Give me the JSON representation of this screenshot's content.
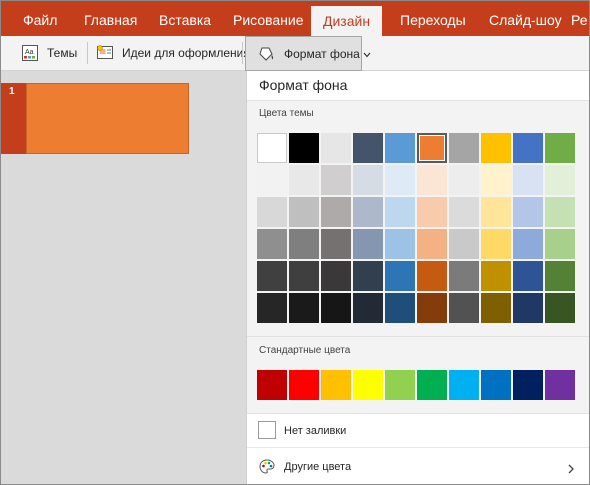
{
  "ribbon": {
    "tabs": [
      {
        "label": "Файл"
      },
      {
        "label": "Главная"
      },
      {
        "label": "Вставка"
      },
      {
        "label": "Рисование"
      },
      {
        "label": "Дизайн",
        "active": true
      },
      {
        "label": "Переходы"
      },
      {
        "label": "Слайд-шоу"
      },
      {
        "label": "Ре"
      }
    ]
  },
  "toolbar": {
    "themes_label": "Темы",
    "design_ideas_label": "Идеи для оформления",
    "format_bg_label": "Формат фона"
  },
  "slides": {
    "items": [
      {
        "number": "1",
        "color": "#ed7d31"
      }
    ]
  },
  "panel": {
    "title": "Формат фона",
    "theme_colors_label": "Цвета темы",
    "standard_colors_label": "Стандартные цвета",
    "no_fill_label": "Нет заливки",
    "more_colors_label": "Другие цвета",
    "selected_color": "#ed7d31",
    "theme_colors": [
      [
        "#ffffff",
        "#000000",
        "#e7e6e6",
        "#44546a",
        "#5b9bd5",
        "#ed7d31",
        "#a5a5a5",
        "#ffc000",
        "#4472c4",
        "#70ad47"
      ],
      [
        "#f2f2f2",
        "#e8e8e8",
        "#d0cece",
        "#d6dce4",
        "#deebf6",
        "#fbe5d5",
        "#ededed",
        "#fff2cc",
        "#d9e2f3",
        "#e2efd9"
      ],
      [
        "#d8d8d8",
        "#bfbfbf",
        "#aeaaaa",
        "#adb9ca",
        "#bdd7ee",
        "#f7cbac",
        "#dbdbdb",
        "#fee599",
        "#b4c6e7",
        "#c5e0b3"
      ],
      [
        "#8f8f8f",
        "#7f7f7f",
        "#757171",
        "#8496b0",
        "#9cc3e5",
        "#f4b183",
        "#c9c9c9",
        "#ffd965",
        "#8eaadb",
        "#a8d08d"
      ],
      [
        "#404040",
        "#3f3f3f",
        "#3a3838",
        "#323f4f",
        "#2e75b5",
        "#c55a11",
        "#7b7b7b",
        "#bf9000",
        "#2f5496",
        "#538135"
      ],
      [
        "#262626",
        "#1a1a1a",
        "#171616",
        "#222a35",
        "#1e4e79",
        "#843c0b",
        "#525252",
        "#7f6000",
        "#203864",
        "#375623"
      ]
    ],
    "standard_colors": [
      "#c00000",
      "#ff0000",
      "#ffc000",
      "#ffff00",
      "#92d050",
      "#00b050",
      "#00b0f0",
      "#0070c0",
      "#002060",
      "#7030a0"
    ]
  }
}
